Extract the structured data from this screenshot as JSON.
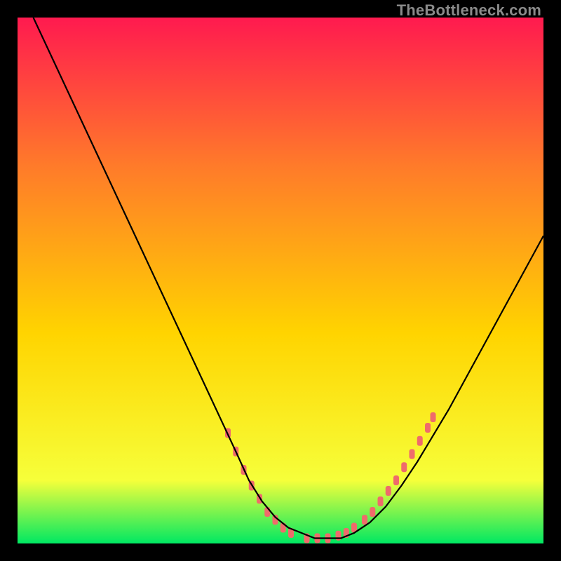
{
  "watermark": "TheBottleneck.com",
  "colors": {
    "gradient_top": "#ff1a4f",
    "gradient_upper_mid": "#ff7a2a",
    "gradient_mid": "#ffd400",
    "gradient_lower_mid": "#f6ff3a",
    "gradient_bottom": "#00e862",
    "background": "#000000",
    "curve": "#000000",
    "marker": "#ef6b6b"
  },
  "chart_data": {
    "type": "line",
    "title": "",
    "xlabel": "",
    "ylabel": "",
    "xlim": [
      0,
      100
    ],
    "ylim": [
      0,
      100
    ],
    "grid": false,
    "legend": false,
    "series": [
      {
        "name": "bottleneck-curve",
        "x": [
          3,
          6.5,
          10,
          13.5,
          17,
          20.5,
          24,
          27.5,
          31,
          34.5,
          38,
          41.5,
          44,
          46.5,
          49,
          51.5,
          54,
          56.5,
          59,
          61.5,
          64,
          67,
          70,
          73,
          76,
          79,
          82,
          85,
          88,
          91,
          94,
          97,
          100
        ],
        "y": [
          100,
          92.5,
          85,
          77.5,
          70,
          62.5,
          55,
          47.5,
          40,
          32.5,
          25,
          17.5,
          12,
          8,
          5,
          3,
          2,
          1,
          1,
          1,
          2,
          4,
          7,
          11,
          15.5,
          20.5,
          25.5,
          31,
          36.5,
          42,
          47.5,
          53,
          58.5
        ]
      }
    ],
    "markers": {
      "name": "highlighted-segments",
      "points": [
        {
          "x": 40,
          "y": 21
        },
        {
          "x": 41.5,
          "y": 17.5
        },
        {
          "x": 43,
          "y": 14
        },
        {
          "x": 44.5,
          "y": 11
        },
        {
          "x": 46,
          "y": 8.5
        },
        {
          "x": 47.5,
          "y": 6
        },
        {
          "x": 49,
          "y": 4.5
        },
        {
          "x": 50.5,
          "y": 3
        },
        {
          "x": 52,
          "y": 2
        },
        {
          "x": 55,
          "y": 1
        },
        {
          "x": 57,
          "y": 1
        },
        {
          "x": 59,
          "y": 1
        },
        {
          "x": 61,
          "y": 1.5
        },
        {
          "x": 62.5,
          "y": 2
        },
        {
          "x": 64,
          "y": 3
        },
        {
          "x": 66,
          "y": 4.5
        },
        {
          "x": 67.5,
          "y": 6
        },
        {
          "x": 69,
          "y": 8
        },
        {
          "x": 70.5,
          "y": 10
        },
        {
          "x": 72,
          "y": 12
        },
        {
          "x": 73.5,
          "y": 14.5
        },
        {
          "x": 75,
          "y": 17
        },
        {
          "x": 76.5,
          "y": 19.5
        },
        {
          "x": 78,
          "y": 22
        },
        {
          "x": 79,
          "y": 24
        }
      ]
    }
  }
}
